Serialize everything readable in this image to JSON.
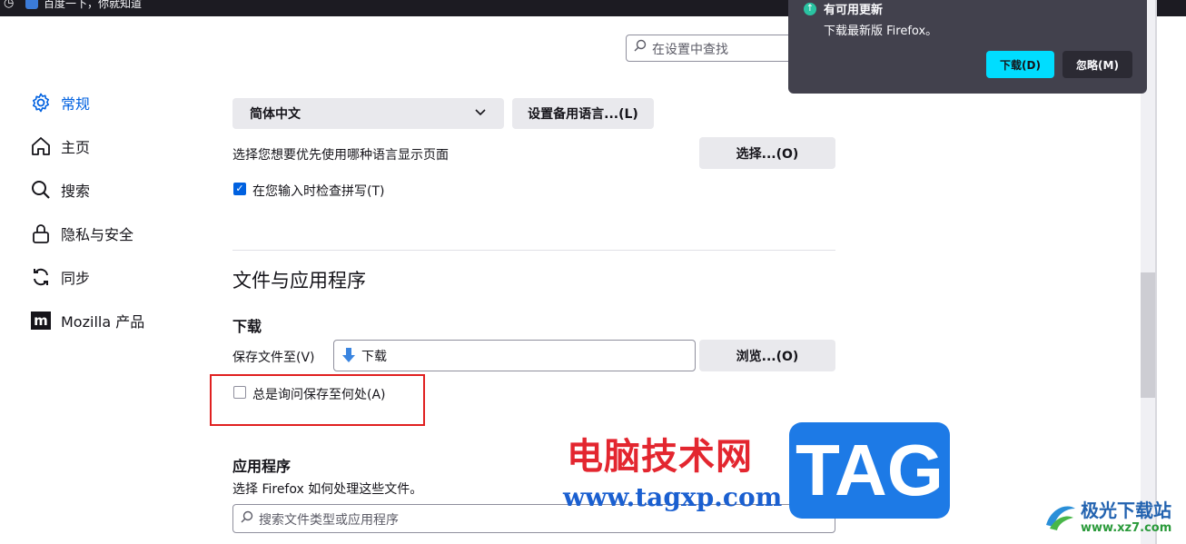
{
  "tab": {
    "title": "百度一下，你就知道"
  },
  "search": {
    "placeholder": "在设置中查找"
  },
  "sidebar": {
    "items": [
      {
        "label": "常规",
        "icon": "gear-icon",
        "active": true
      },
      {
        "label": "主页",
        "icon": "home-icon"
      },
      {
        "label": "搜索",
        "icon": "search-icon"
      },
      {
        "label": "隐私与安全",
        "icon": "lock-icon"
      },
      {
        "label": "同步",
        "icon": "sync-icon"
      },
      {
        "label": "Mozilla 产品",
        "icon": "mozilla-icon"
      }
    ]
  },
  "language": {
    "selected": "简体中文",
    "alt_button": "设置备用语言...(L)",
    "prompt": "选择您想要优先使用哪种语言显示页面",
    "choose_button": "选择...(O)",
    "spellcheck_label": "在您输入时检查拼写(T)",
    "spellcheck_checked": true
  },
  "files": {
    "heading": "文件与应用程序",
    "downloads_heading": "下载",
    "save_to_label": "保存文件至(V)",
    "save_to_value": "下载",
    "browse_button": "浏览...(O)",
    "always_ask_label": "总是询问保存至何处(A)",
    "always_ask_checked": false
  },
  "apps": {
    "heading": "应用程序",
    "description": "选择 Firefox 如何处理这些文件。",
    "search_placeholder": "搜索文件类型或应用程序"
  },
  "update_popup": {
    "title": "有可用更新",
    "message": "下载最新版 Firefox。",
    "download_button": "下载(D)",
    "ignore_button": "忽略(M)"
  },
  "watermark": {
    "cn": "电脑技术网",
    "url": "www.tagxp.com",
    "tag": "TAG",
    "site_name": "极光下载站",
    "site_url": "www.xz7.com"
  },
  "colors": {
    "accent": "#0061e0",
    "highlight_box": "#e02020",
    "popup_bg": "#42414d",
    "popup_primary": "#00ddff"
  }
}
